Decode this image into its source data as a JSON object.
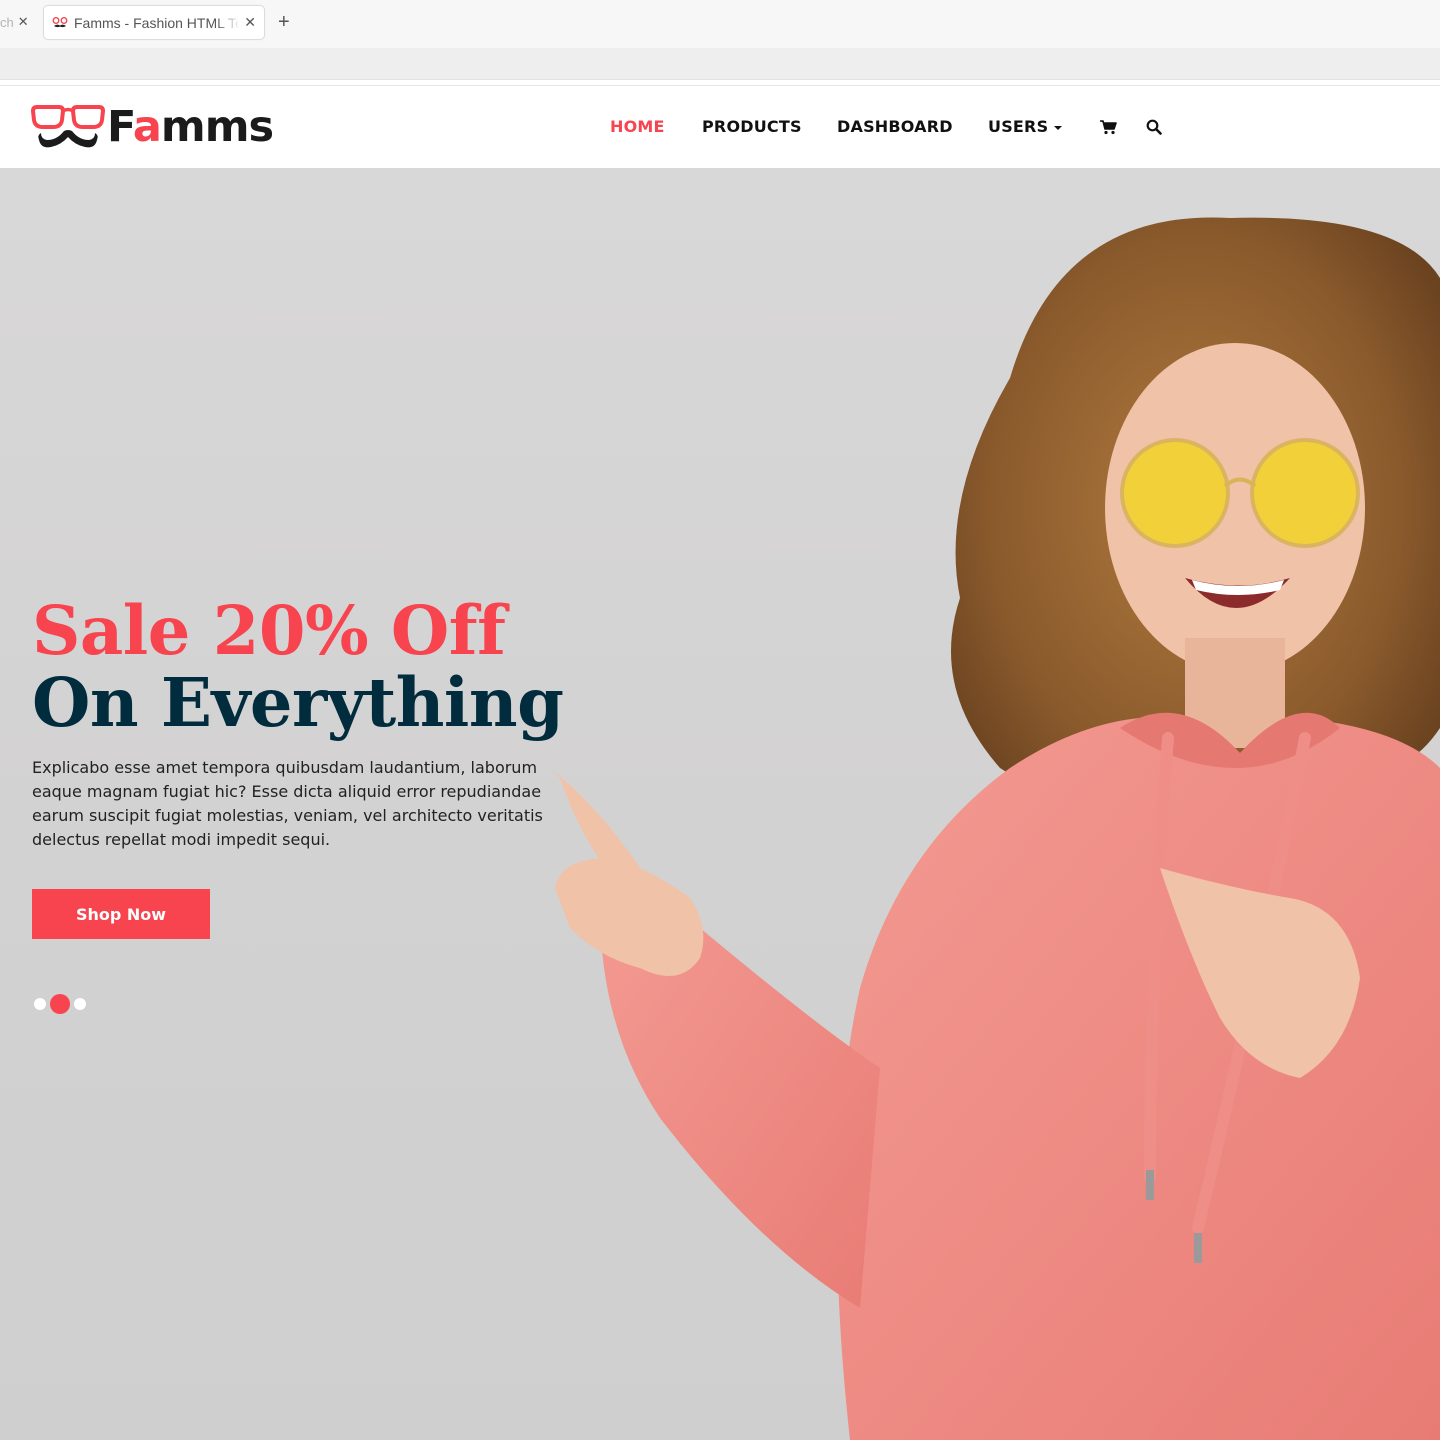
{
  "browser": {
    "prev_tab_fragment": "ch",
    "tab_title": "Famms - Fashion HTML Template",
    "new_tab_symbol": "+"
  },
  "header": {
    "logo_text_prefix": "F",
    "logo_text_accent": "a",
    "logo_text_suffix": "mms",
    "nav": {
      "home": "HOME",
      "products": "PRODUCTS",
      "dashboard": "DASHBOARD",
      "users": "USERS"
    },
    "icons": [
      "cart-icon",
      "search-icon"
    ]
  },
  "hero": {
    "title_line1": "Sale 20% Off",
    "title_line2": "On Everything",
    "text": "Explicabo esse amet tempora quibusdam laudantium, laborum eaque magnam fugiat hic? Esse dicta aliquid error repudiandae earum suscipit fugiat molestias, veniam, vel architecto veritatis delectus repellat modi impedit sequi.",
    "button_label": "Shop Now",
    "slides_count": 3,
    "active_slide": 2
  },
  "colors": {
    "accent": "#f7444e",
    "title_dark": "#002c3e",
    "hero_bg": "#d5d4d4",
    "hoodie": "#f08a82"
  }
}
